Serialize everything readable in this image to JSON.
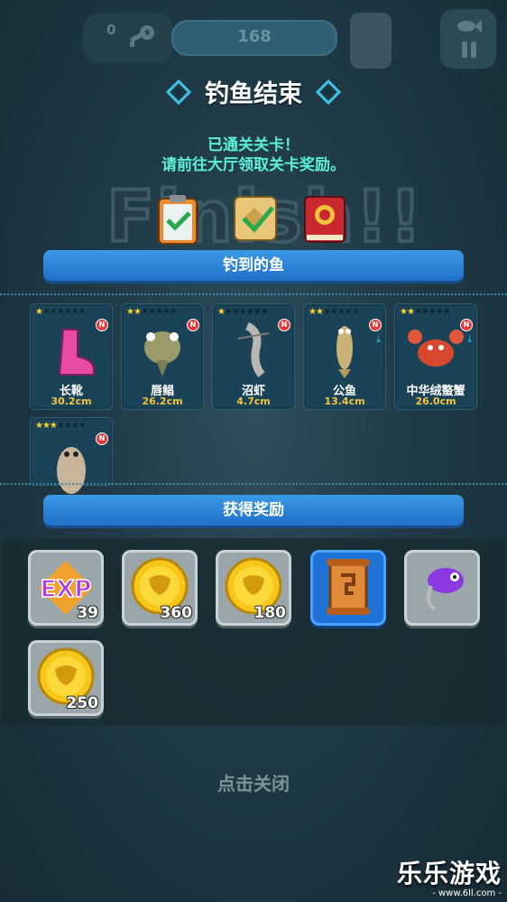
{
  "header": {
    "key_count": "0",
    "level": "168"
  },
  "title": "钓鱼结束",
  "message": {
    "line1": "已通关关卡！",
    "line2": "请前往大厅领取关卡奖励。"
  },
  "background_text": "Finish!!",
  "sections": {
    "caught_fish": "钓到的鱼",
    "rewards": "获得奖励"
  },
  "fish": [
    {
      "name": "长靴",
      "size": "30.2cm",
      "stars": 1,
      "is_new": true,
      "new_label": "N",
      "icon": "pink-boot-icon"
    },
    {
      "name": "唇鲳",
      "size": "26.2cm",
      "stars": 2,
      "is_new": true,
      "new_label": "N",
      "icon": "catfish-icon"
    },
    {
      "name": "沼虾",
      "size": "4.7cm",
      "stars": 1,
      "is_new": true,
      "new_label": "N",
      "icon": "shrimp-icon"
    },
    {
      "name": "公鱼",
      "size": "13.4cm",
      "stars": 2,
      "is_new": true,
      "new_label": "N",
      "icon": "fish-icon"
    },
    {
      "name": "中华绒螯蟹",
      "size": "26.0cm",
      "stars": 2,
      "is_new": true,
      "new_label": "N",
      "icon": "crab-icon"
    },
    {
      "name": "",
      "size": "",
      "stars": 3,
      "is_new": true,
      "new_label": "N",
      "icon": "flatfish-icon"
    }
  ],
  "rewards": [
    {
      "type": "exp",
      "label": "EXP",
      "qty": "39",
      "icon": "exp-icon"
    },
    {
      "type": "coin",
      "qty": "360",
      "icon": "gold-coin-icon"
    },
    {
      "type": "coin",
      "qty": "180",
      "icon": "gold-coin-icon"
    },
    {
      "type": "scroll",
      "qty": "",
      "icon": "map-scroll-icon",
      "selected": true
    },
    {
      "type": "lure",
      "qty": "",
      "icon": "purple-lure-icon"
    },
    {
      "type": "coin",
      "qty": "250",
      "icon": "gold-coin-icon"
    }
  ],
  "close_hint": "点击关闭",
  "watermark": {
    "brand": "乐乐游戏",
    "url": "- www.6ll.com -"
  },
  "colors": {
    "accent_blue": "#2f86df",
    "message_cyan": "#5cf0d6",
    "star_gold": "#ffd12a",
    "size_gold": "#f2c440"
  }
}
